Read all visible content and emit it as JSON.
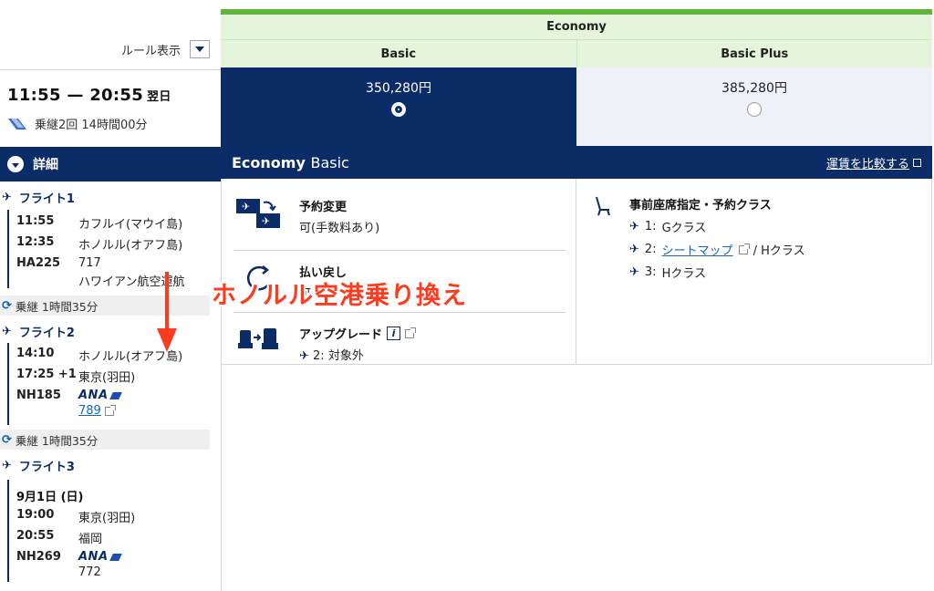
{
  "left": {
    "rule_label": "ルール表示",
    "time_range": "11:55 — 20:55",
    "next_day": "翌日",
    "transit_summary": "乗継2回 14時間00分",
    "detail_label": "詳細",
    "flights": [
      {
        "label": "フライト1",
        "dep_time": "11:55",
        "dep_airport": "カフルイ(マウイ島)",
        "arr_time": "12:35",
        "arr_airport": "ホノルル(オアフ島)",
        "flight_no": "HA225",
        "aircraft": "717",
        "operator": "ハワイアン航空運航"
      },
      {
        "label": "フライト2",
        "dep_time": "14:10",
        "dep_airport": "ホノルル(オアフ島)",
        "arr_time": "17:25 +1",
        "arr_airport": "東京(羽田)",
        "flight_no": "NH185",
        "airline_logo": "ANA",
        "aircraft": "789"
      },
      {
        "label": "フライト3",
        "date": "9月1日 (日)",
        "dep_time": "19:00",
        "dep_airport": "東京(羽田)",
        "arr_time": "20:55",
        "arr_airport": "福岡",
        "flight_no": "NH269",
        "airline_logo": "ANA",
        "aircraft": "772"
      }
    ],
    "transfers": [
      "乗継 1時間35分",
      "乗継 1時間35分"
    ]
  },
  "fare": {
    "cabin": "Economy",
    "tiers": [
      {
        "name": "Basic",
        "price": "350,280円",
        "selected": true
      },
      {
        "name": "Basic Plus",
        "price": "385,280円",
        "selected": false
      }
    ],
    "bar_title_bold": "Economy",
    "bar_title_light": "Basic",
    "compare_link": "運賃を比較する",
    "conditions": {
      "change_title": "予約変更",
      "change_value": "可(手数料あり)",
      "refund_title": "払い戻し",
      "refund_value": "可",
      "upgrade_title": "アップグレード",
      "upgrade_value": "2: 対象外",
      "seat_title": "事前座席指定・予約クラス",
      "seat_lines": [
        {
          "prefix": "1:",
          "link": "",
          "class": "Gクラス"
        },
        {
          "prefix": "2:",
          "link": "シートマップ",
          "class": "/ Hクラス"
        },
        {
          "prefix": "3:",
          "link": "",
          "class": "Hクラス"
        }
      ]
    }
  },
  "overlay": {
    "text": "ホノルル空港乗り換え",
    "color": "#ff3b1f"
  },
  "colors": {
    "navy": "#0b2c67",
    "green": "#5db53a",
    "light_green": "#e4f5dc",
    "link": "#1167c2"
  }
}
